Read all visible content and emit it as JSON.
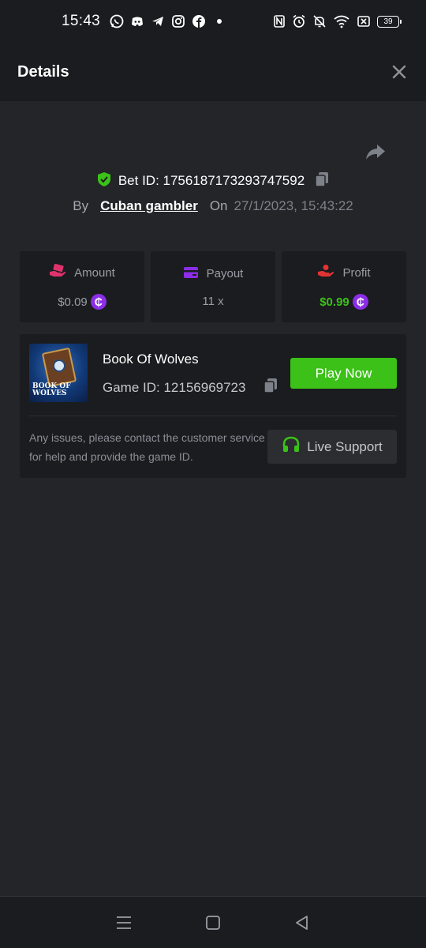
{
  "status_bar": {
    "time": "15:43",
    "battery": "39",
    "icons": [
      "whatsapp-icon",
      "discord-icon",
      "telegram-icon",
      "instagram-icon",
      "facebook-icon",
      "dot-icon",
      "nfc-icon",
      "alarm-icon",
      "mute-icon",
      "wifi-icon",
      "sim-icon",
      "battery-icon"
    ]
  },
  "header": {
    "title": "Details"
  },
  "bet": {
    "id_label": "Bet ID: 1756187173293747592",
    "by_label": "By",
    "user": "Cuban gambler",
    "on_label": "On",
    "date": "27/1/2023, 15:43:22"
  },
  "stats": [
    {
      "label": "Amount",
      "value": "$0.09",
      "icon": "money-hand-icon",
      "icon_color": "#e0336c"
    },
    {
      "label": "Payout",
      "value": "11 x",
      "icon": "card-icon",
      "icon_color": "#8c2de8"
    },
    {
      "label": "Profit",
      "value": "$0.99",
      "icon": "coins-hand-icon",
      "icon_color": "#e03434"
    }
  ],
  "coin_symbol": "₵",
  "game": {
    "name": "Book Of Wolves",
    "id_label": "Game ID: 12156969723",
    "thumb_text_1": "BOOK OF",
    "thumb_text_2": "WOLVES",
    "play_label": "Play Now",
    "support_text": "Any issues, please contact the customer service for help and provide the game ID.",
    "support_label": "Live Support"
  },
  "colors": {
    "accent_green": "#3bc117",
    "coin_purple": "#8c2de8",
    "background": "#232528",
    "panel": "#1b1c1f"
  }
}
